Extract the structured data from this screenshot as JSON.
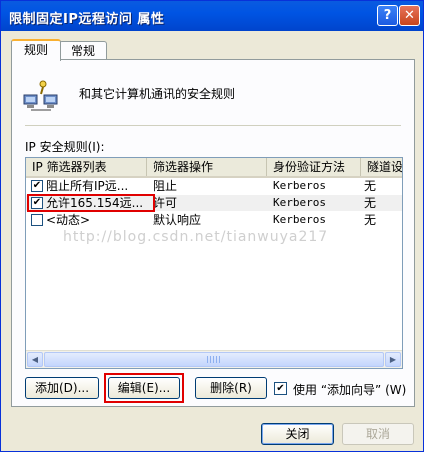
{
  "window": {
    "title": "限制固定IP远程访问 属性",
    "help": "?",
    "close": "✕"
  },
  "tabs": [
    {
      "label": "规则"
    },
    {
      "label": "常规"
    }
  ],
  "description": "和其它计算机通讯的安全规则",
  "list": {
    "label": "IP 安全规则(I):",
    "columns": [
      "IP 筛选器列表",
      "筛选器操作",
      "身份验证方法",
      "隧道设"
    ],
    "rows": [
      {
        "checked": true,
        "filter": "阻止所有IP远...",
        "action": "阻止",
        "auth": "Kerberos",
        "tunnel": "无"
      },
      {
        "checked": true,
        "filter": "允许165.154远...",
        "action": "许可",
        "auth": "Kerberos",
        "tunnel": "无"
      },
      {
        "checked": false,
        "filter": "<动态>",
        "action": "默认响应",
        "auth": "Kerberos",
        "tunnel": "无"
      }
    ]
  },
  "buttons": {
    "add": "添加(D)...",
    "edit": "编辑(E)...",
    "remove": "删除(R)",
    "close": "关闭",
    "cancel": "取消"
  },
  "wizard": {
    "checked": true,
    "label": "使用 “添加向导” (W)"
  },
  "watermark": "http://blog.csdn.net/tianwuya217"
}
